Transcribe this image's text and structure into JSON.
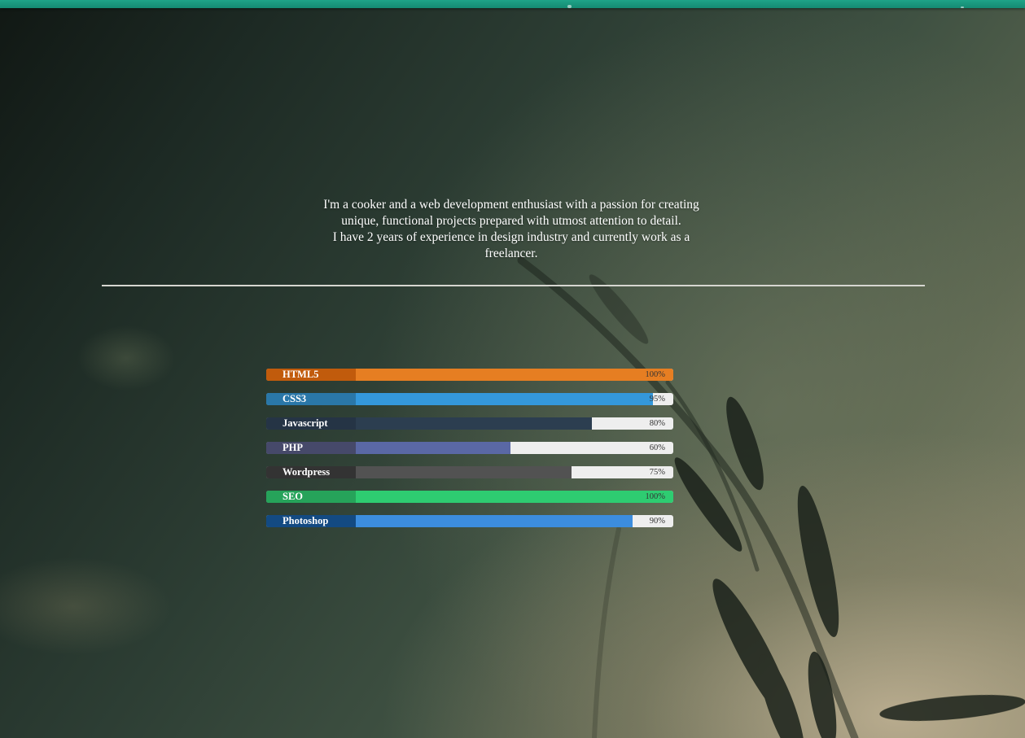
{
  "intro": {
    "line1": "I'm a cooker and a web development enthusiast with a passion for creating unique, functional projects prepared with utmost attention to detail.",
    "line2": "I have 2 years of experience in design industry and currently work as a freelancer."
  },
  "skills": [
    {
      "name": "HTML5",
      "percent_text": "100%",
      "percent": 100,
      "bar_color": "#e67e22",
      "label_color": "#c15b0c"
    },
    {
      "name": "CSS3",
      "percent_text": "95%",
      "percent": 95,
      "bar_color": "#3498db",
      "label_color": "#2a77a8"
    },
    {
      "name": "Javascript",
      "percent_text": "80%",
      "percent": 80,
      "bar_color": "#2c3e50",
      "label_color": "#253445"
    },
    {
      "name": "PHP",
      "percent_text": "60%",
      "percent": 60,
      "bar_color": "#5a68a5",
      "label_color": "#46496a"
    },
    {
      "name": "Wordpress",
      "percent_text": "75%",
      "percent": 75,
      "bar_color": "#525252",
      "label_color": "#333333"
    },
    {
      "name": "SEO",
      "percent_text": "100%",
      "percent": 100,
      "bar_color": "#2ecc71",
      "label_color": "#26a35a"
    },
    {
      "name": "Photoshop",
      "percent_text": "90%",
      "percent": 90,
      "bar_color": "#3c8dde",
      "label_color": "#134a82"
    }
  ]
}
